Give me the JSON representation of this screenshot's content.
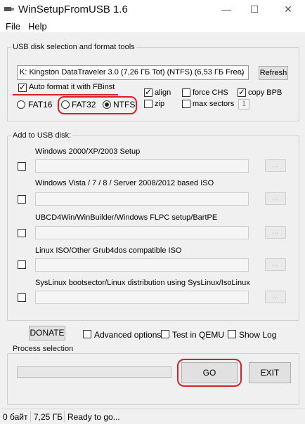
{
  "window": {
    "title": "WinSetupFromUSB 1.6",
    "controls": {
      "minimize": "—",
      "maximize": "☐",
      "close": "✕"
    }
  },
  "menu": [
    "File",
    "Help"
  ],
  "usb_group": {
    "title": "USB disk selection and format tools",
    "disk_selected": "K: Kingston DataTraveler 3.0 (7,26 ГБ Tot) (NTFS) (6,53 ГБ Free)",
    "refresh_label": "Refresh",
    "auto_format": {
      "label": "Auto format it with FBinst",
      "checked": true
    },
    "fs_options": [
      {
        "label": "FAT16",
        "selected": false
      },
      {
        "label": "FAT32",
        "selected": false
      },
      {
        "label": "NTFS",
        "selected": true
      }
    ],
    "align": {
      "label": "align",
      "checked": true
    },
    "zip": {
      "label": "zip",
      "checked": false
    },
    "force_chs": {
      "label": "force CHS",
      "checked": false
    },
    "max_sectors": {
      "label": "max sectors",
      "checked": false,
      "value": "1"
    },
    "copy_bpb": {
      "label": "copy BPB",
      "checked": true
    }
  },
  "add_group": {
    "title": "Add to USB disk:",
    "items": [
      {
        "label": "Windows 2000/XP/2003 Setup",
        "browse": "..."
      },
      {
        "label": "Windows Vista / 7 / 8 / Server 2008/2012 based ISO",
        "browse": "..."
      },
      {
        "label": "UBCD4Win/WinBuilder/Windows FLPC setup/BartPE",
        "browse": "..."
      },
      {
        "label": "Linux ISO/Other Grub4dos compatible ISO",
        "browse": "..."
      },
      {
        "label": "SysLinux bootsector/Linux distribution using SysLinux/IsoLinux",
        "browse": "..."
      }
    ]
  },
  "options": {
    "donate": "DONATE",
    "advanced": "Advanced options",
    "qemu": "Test in QEMU",
    "show_log": "Show Log"
  },
  "process": {
    "title": "Process selection",
    "progress": 0,
    "go": "GO",
    "exit": "EXIT"
  },
  "status": {
    "size_used": "0 байт",
    "size_total": "7,25 ГБ",
    "message": "Ready to go..."
  },
  "colors": {
    "highlight": "#d8202a",
    "client_bg": "#f0f0f0"
  }
}
